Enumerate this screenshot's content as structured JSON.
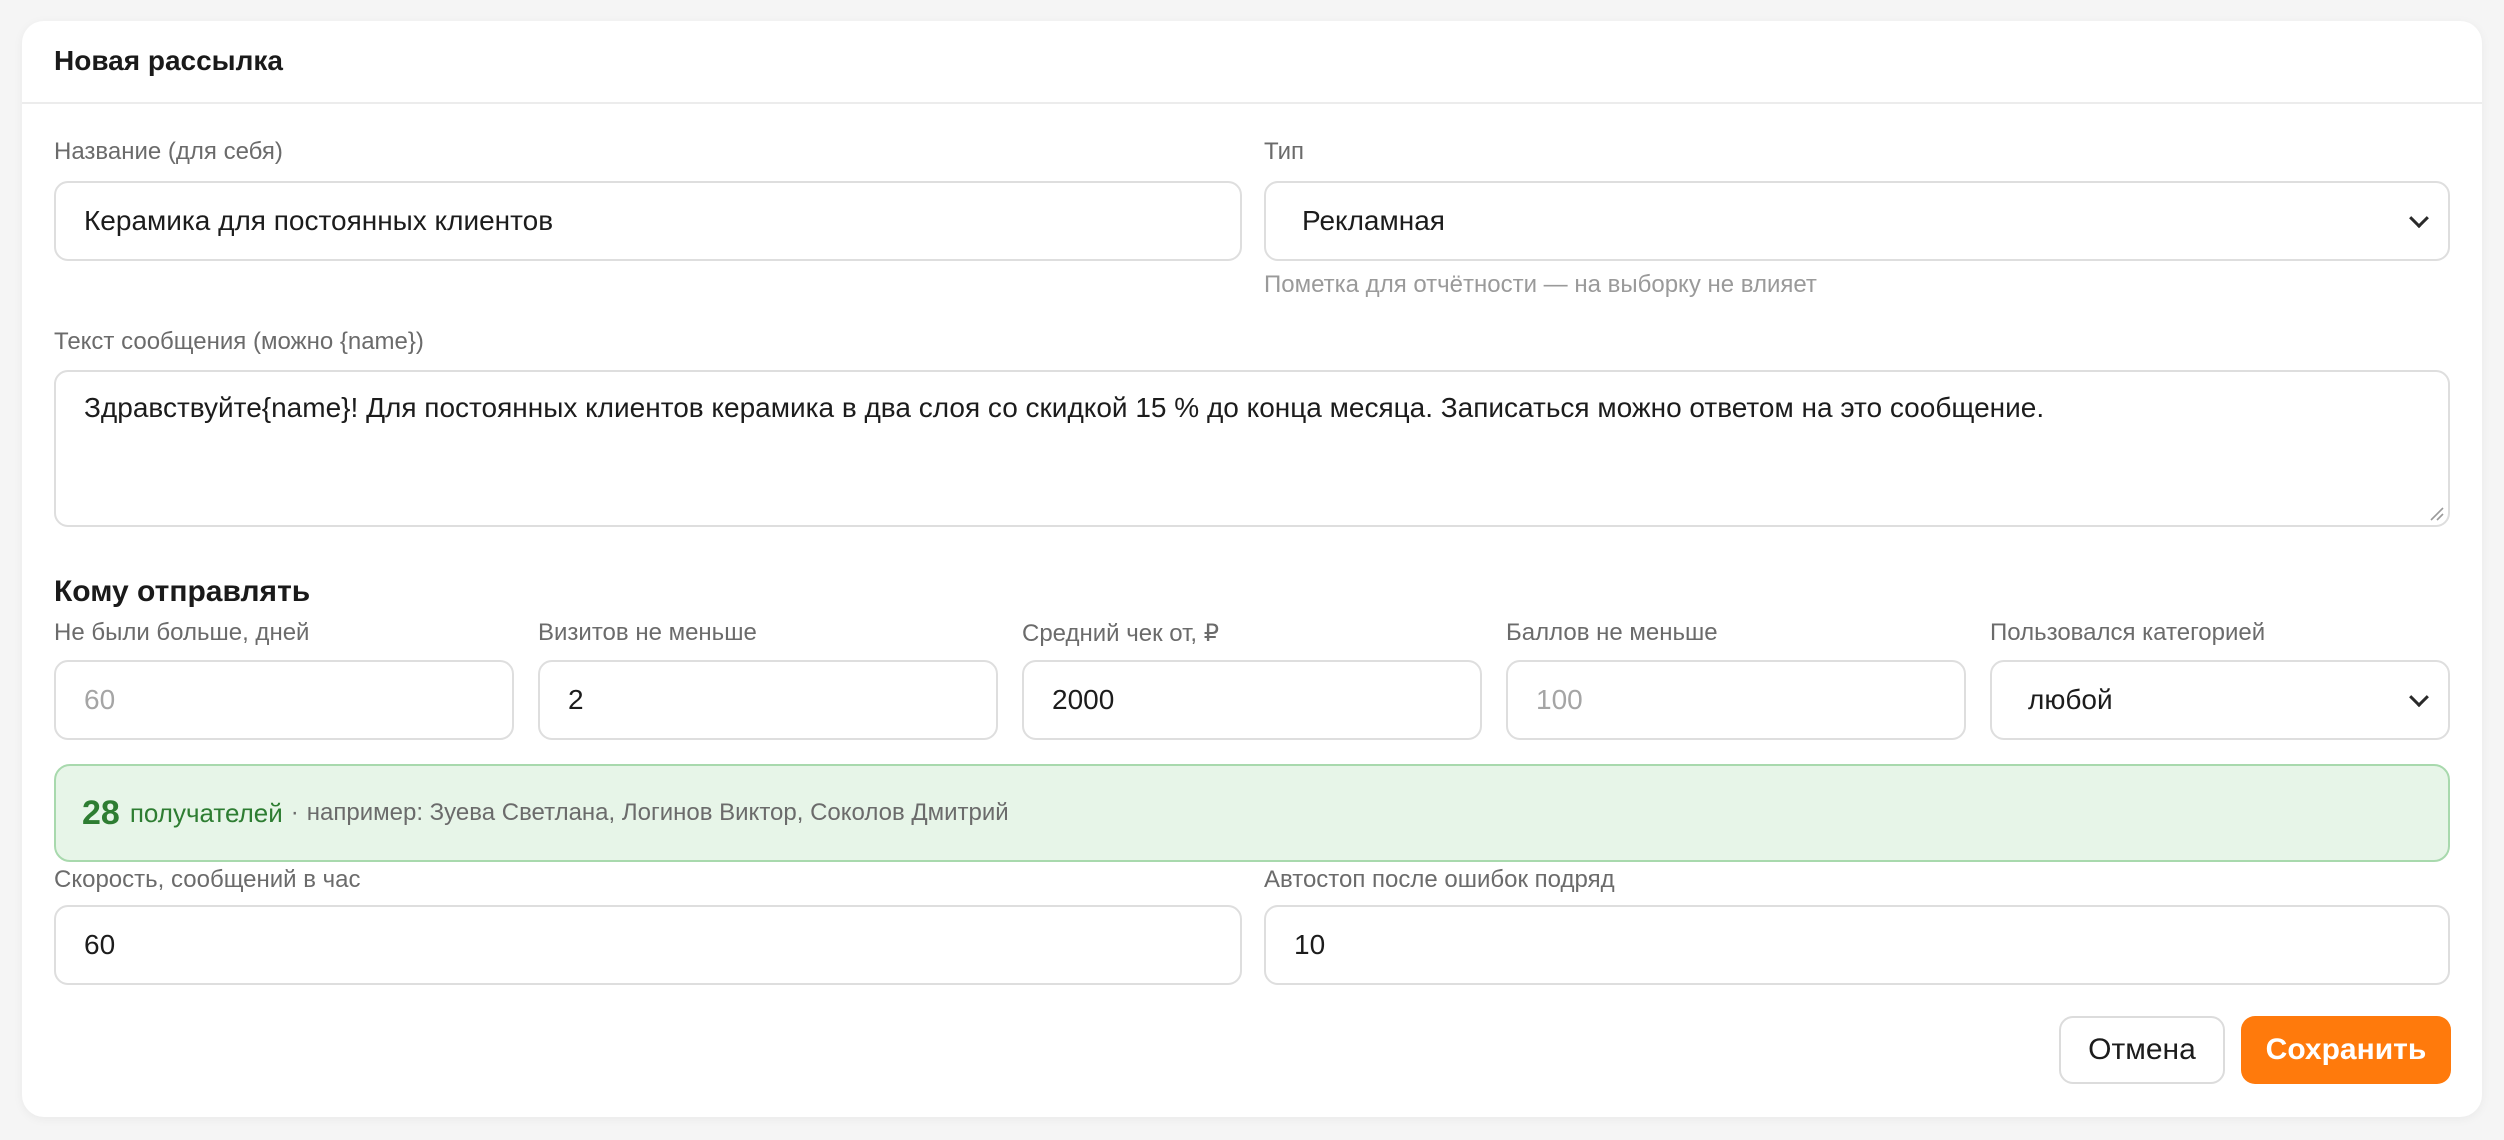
{
  "header": {
    "title": "Новая рассылка"
  },
  "form": {
    "name": {
      "label": "Название (для себя)",
      "value": "Керамика для постоянных клиентов"
    },
    "type": {
      "label": "Тип",
      "value": "Рекламная",
      "hint": "Пометка для отчётности — на выборку не влияет"
    },
    "message": {
      "label": "Текст сообщения (можно {name})",
      "value": "Здравствуйте{name}! Для постоянных клиентов керамика в два слоя со скидкой 15 % до конца месяца. Записаться можно ответом на это сообщение."
    }
  },
  "audience": {
    "title": "Кому отправлять",
    "filters": [
      {
        "label": "Не были больше, дней",
        "placeholder": "60"
      },
      {
        "label": "Визитов не меньше",
        "value": "2"
      },
      {
        "label": "Средний чек от, ₽",
        "value": "2000"
      },
      {
        "label": "Баллов не меньше",
        "placeholder": "100"
      },
      {
        "label": "Пользовался категорией",
        "value": "любой"
      }
    ],
    "recipients": {
      "count": "28",
      "word": "получателей",
      "separator": "·",
      "example": "например: Зуева Светлана, Логинов Виктор, Соколов Дмитрий"
    }
  },
  "sending": {
    "speed": {
      "label": "Скорость, сообщений в час",
      "value": "60"
    },
    "autostop": {
      "label": "Автостоп после ошибок подряд",
      "value": "10"
    }
  },
  "actions": {
    "cancel": "Отмена",
    "save": "Сохранить"
  },
  "colors": {
    "accent": "#ff7a0c",
    "success_text": "#2e7d32",
    "success_bg": "#e7f5e8",
    "success_border": "#a8d9ad"
  }
}
